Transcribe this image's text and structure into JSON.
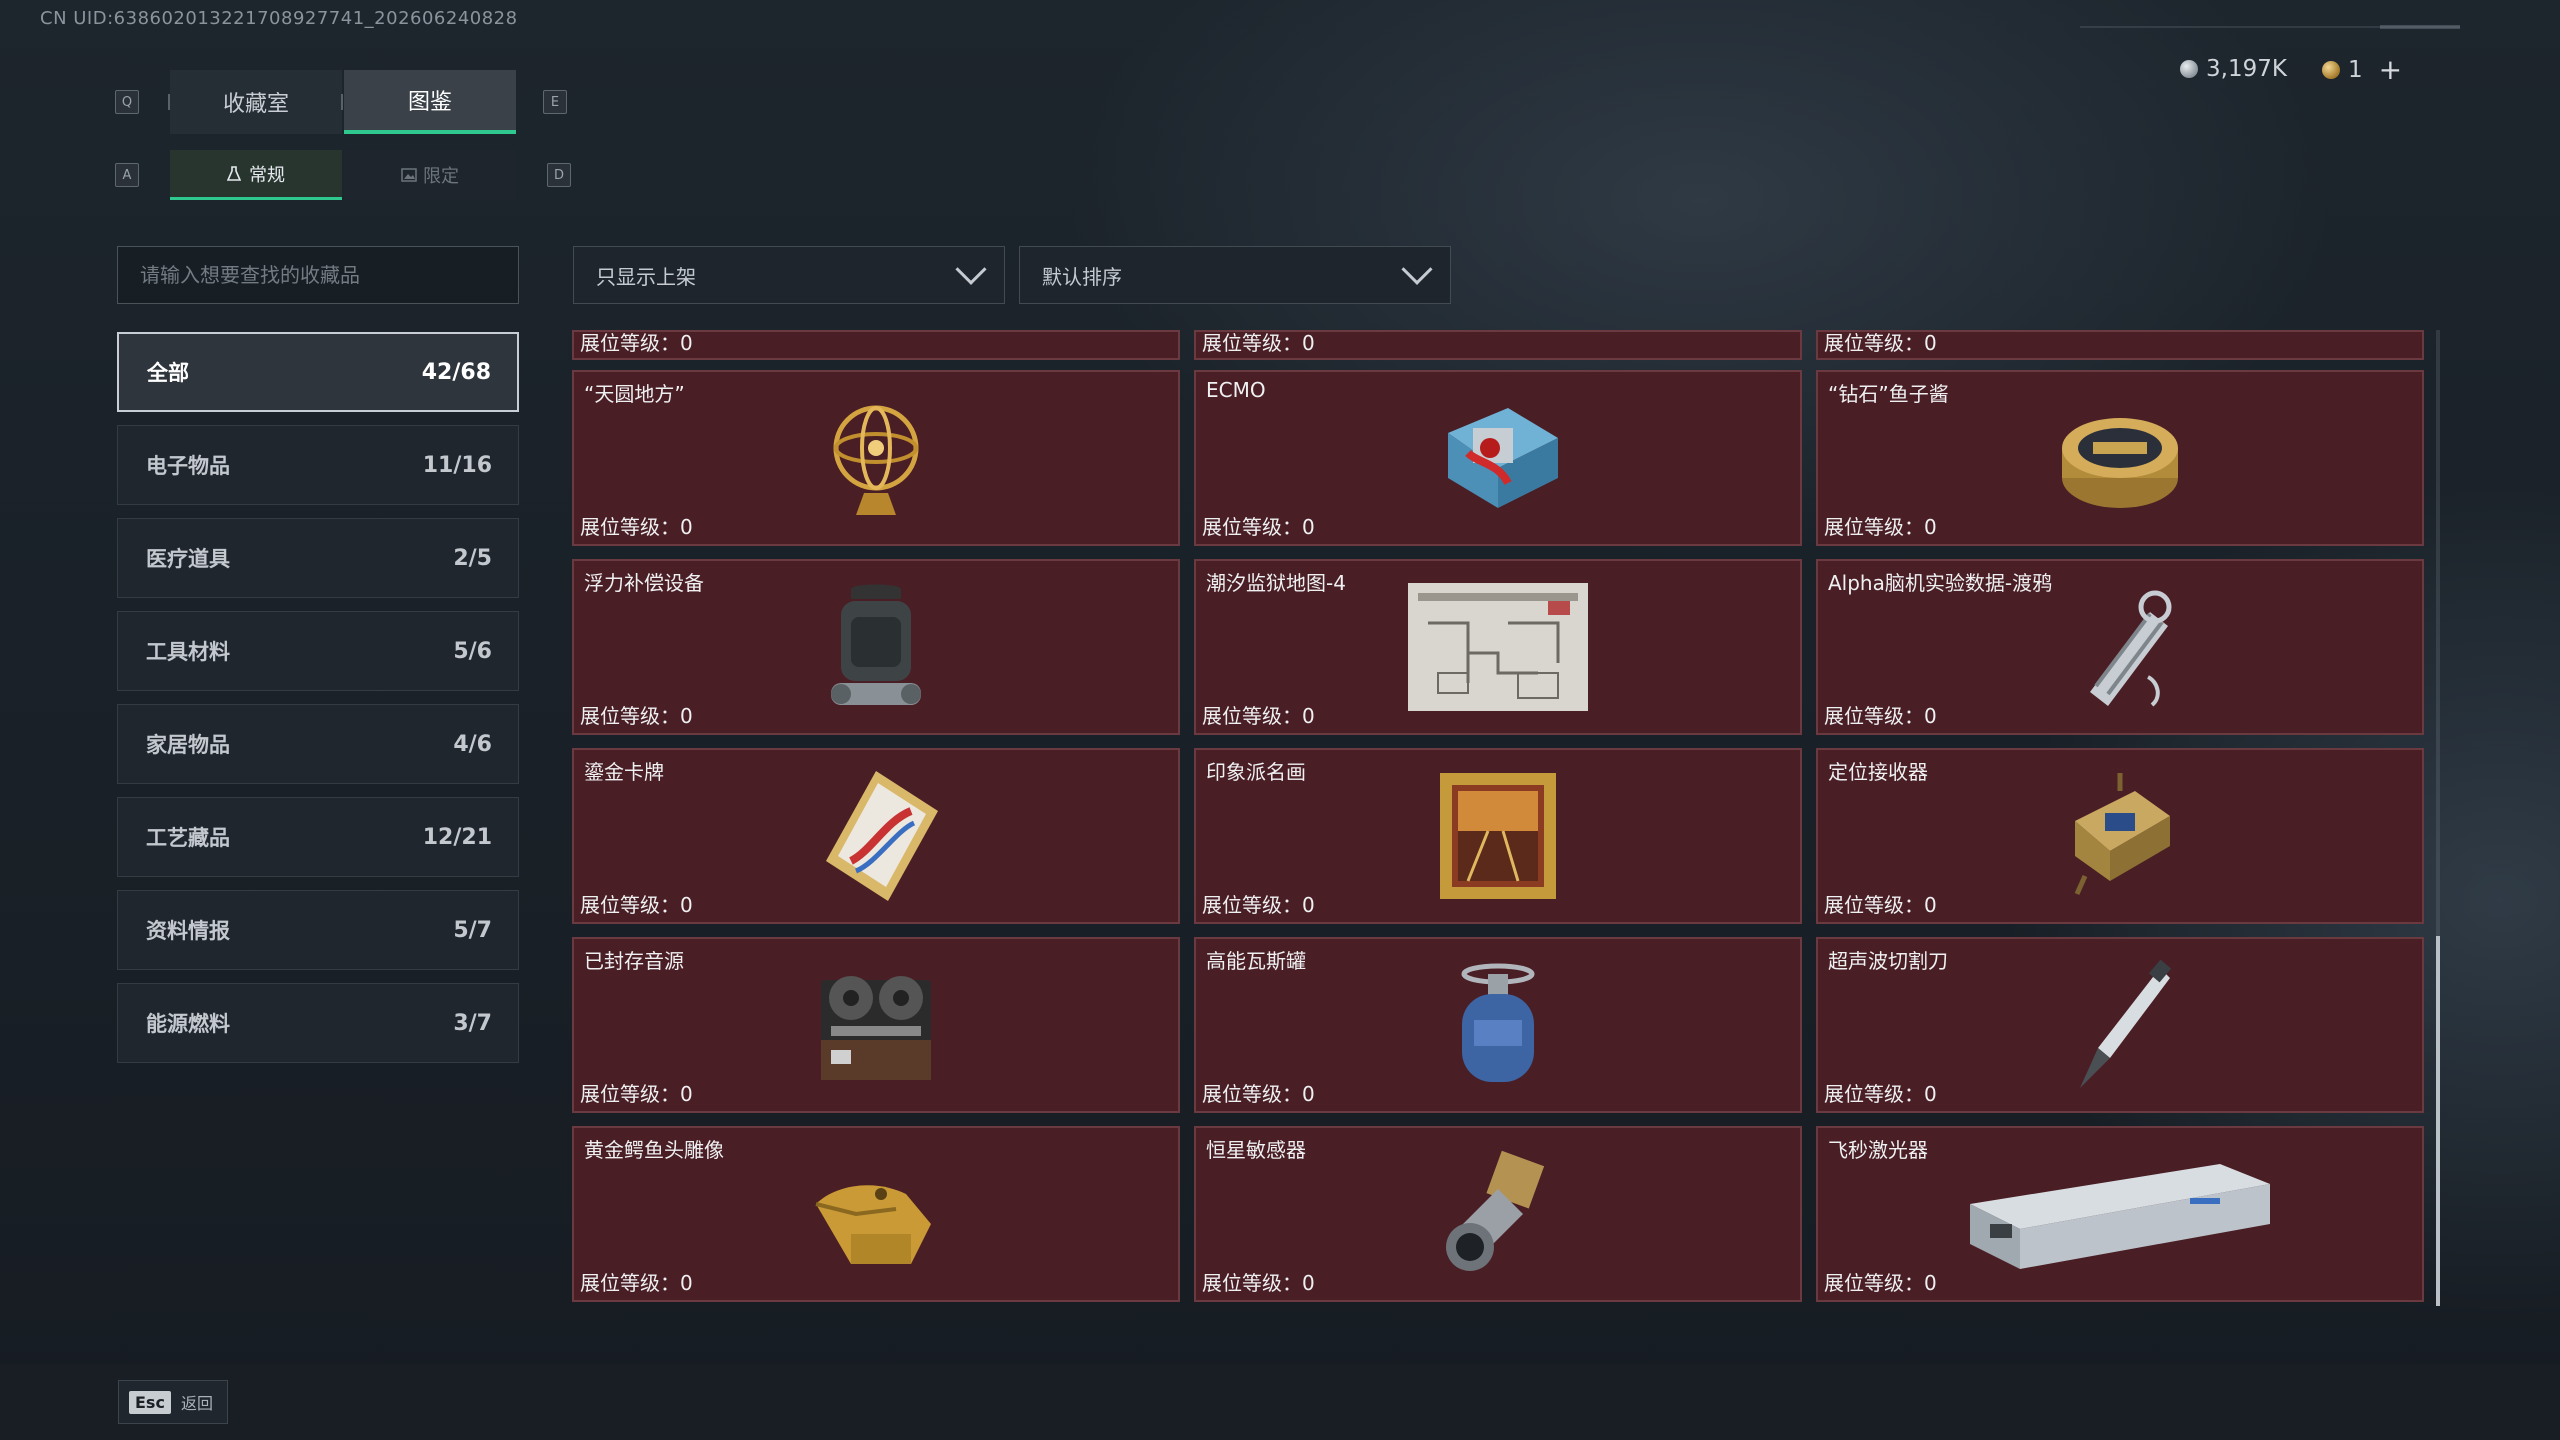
{
  "uid": "CN UID:638602013221708927741_202606240828",
  "currency": {
    "silver": "3,197K",
    "gold": "1"
  },
  "main_tabs": [
    {
      "label": "收藏室"
    },
    {
      "label": "图鉴"
    }
  ],
  "main_tab_keys": {
    "left": "Q",
    "right": "E"
  },
  "sub_tabs": [
    {
      "label": "常规"
    },
    {
      "label": "限定"
    }
  ],
  "sub_tab_keys": {
    "left": "A",
    "right": "D"
  },
  "search": {
    "placeholder": "请输入想要查找的收藏品"
  },
  "filters": {
    "shelf": "只显示上架",
    "sort": "默认排序"
  },
  "categories": [
    {
      "label": "全部",
      "count": "42/68"
    },
    {
      "label": "电子物品",
      "count": "11/16"
    },
    {
      "label": "医疗道具",
      "count": "2/5"
    },
    {
      "label": "工具材料",
      "count": "5/6"
    },
    {
      "label": "家居物品",
      "count": "4/6"
    },
    {
      "label": "工艺藏品",
      "count": "12/21"
    },
    {
      "label": "资料情报",
      "count": "5/7"
    },
    {
      "label": "能源燃料",
      "count": "3/7"
    }
  ],
  "level_label": "展位等级：0",
  "items": [
    {
      "name": "“天圆地方”",
      "icon": "armillary-sphere-icon"
    },
    {
      "name": "ECMO",
      "icon": "ecmo-machine-icon"
    },
    {
      "name": "“钻石”鱼子酱",
      "icon": "caviar-tin-icon"
    },
    {
      "name": "浮力补偿设备",
      "icon": "buoyancy-device-icon"
    },
    {
      "name": "潮汐监狱地图-4",
      "icon": "prison-map-icon"
    },
    {
      "name": "Alpha脑机实验数据-渡鸦",
      "icon": "data-drive-icon"
    },
    {
      "name": "鎏金卡牌",
      "icon": "gilded-card-icon"
    },
    {
      "name": "印象派名画",
      "icon": "framed-painting-icon"
    },
    {
      "name": "定位接收器",
      "icon": "locator-receiver-icon"
    },
    {
      "name": "已封存音源",
      "icon": "tape-recorder-icon"
    },
    {
      "name": "高能瓦斯罐",
      "icon": "gas-canister-icon"
    },
    {
      "name": "超声波切割刀",
      "icon": "ultrasonic-knife-icon"
    },
    {
      "name": "黄金鳄鱼头雕像",
      "icon": "gold-crocodile-icon"
    },
    {
      "name": "恒星敏感器",
      "icon": "star-sensor-icon"
    },
    {
      "name": "飞秒激光器",
      "icon": "femtosecond-laser-icon"
    }
  ],
  "bottom": {
    "esc_key": "Esc",
    "back_label": "返回"
  }
}
